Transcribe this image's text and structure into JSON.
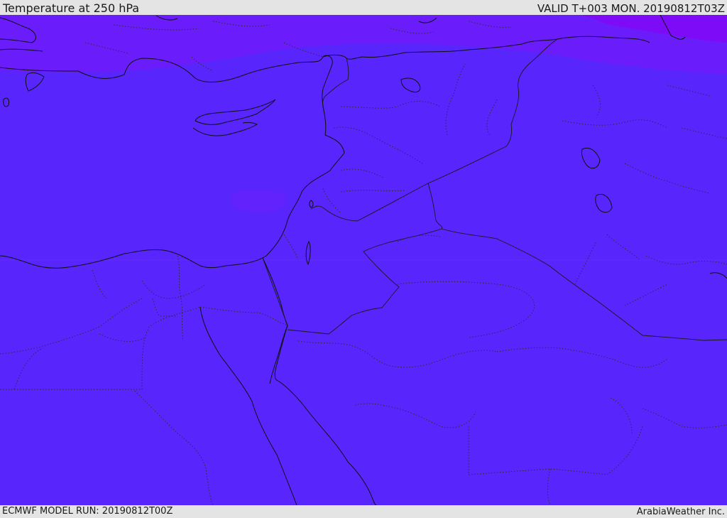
{
  "header": {
    "title": "Temperature at 250 hPa",
    "valid_time": "VALID T+003 MON. 20190812T03Z"
  },
  "footer": {
    "model_run": "ECMWF MODEL RUN: 20190812T00Z",
    "credit": "ArabiaWeather Inc."
  },
  "colors": {
    "field_main": "#5825fd",
    "field_cold": "#6a1cfa",
    "field_coldest": "#7d0bf7",
    "coast_line": "#101010",
    "border_line": "#1a1a1a"
  }
}
